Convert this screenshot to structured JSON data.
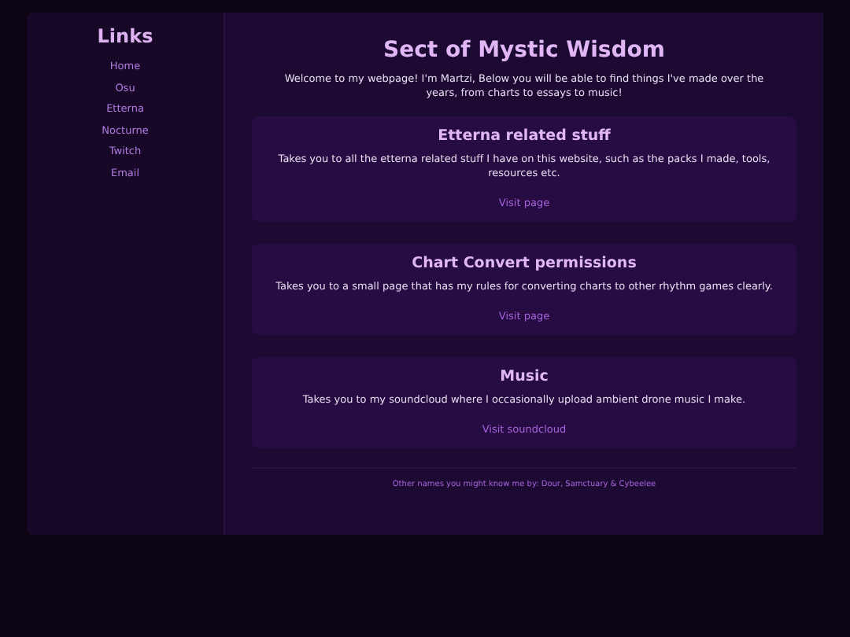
{
  "sidebar": {
    "title": "Links",
    "items": [
      "Home",
      "Osu",
      "Etterna",
      "Nocturne",
      "Twitch",
      "Email"
    ]
  },
  "header": {
    "title": "Sect of Mystic Wisdom",
    "intro": "Welcome to my webpage! I'm Martzi, Below you will be able to find things I've made over the years, from charts to essays to music!"
  },
  "cards": [
    {
      "title": "Etterna related stuff",
      "description": "Takes you to all the etterna related stuff I have on this website, such as the packs I made, tools, resources etc.",
      "link": "Visit page"
    },
    {
      "title": "Chart Convert permissions",
      "description": "Takes you to a small page that has my rules for converting charts to other rhythm games clearly.",
      "link": "Visit page"
    },
    {
      "title": "Music",
      "description": "Takes you to my soundcloud where I occasionally upload ambient drone music I make.",
      "link": "Visit soundcloud"
    }
  ],
  "footer": "Other names you might know me by: Dour, Samctuary & Cybeelee"
}
